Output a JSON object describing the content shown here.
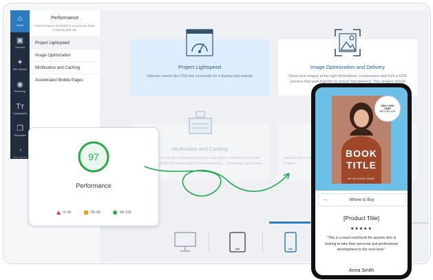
{
  "sidebar": {
    "items": [
      {
        "label": "Home",
        "icon": "home-icon",
        "glyph": "⌂"
      },
      {
        "label": "Themes",
        "icon": "themes-icon",
        "glyph": "▣"
      },
      {
        "label": "Site Wizard",
        "icon": "wand-icon",
        "glyph": "✦"
      },
      {
        "label": "Branding",
        "icon": "palette-icon",
        "glyph": "◉"
      },
      {
        "label": "Typography",
        "icon": "typography-icon",
        "glyph": "Tт"
      },
      {
        "label": "Templates",
        "icon": "templates-icon",
        "glyph": "❐"
      },
      {
        "label": "Site Speed",
        "icon": "gauge-icon",
        "glyph": "◔"
      }
    ]
  },
  "panel": {
    "title": "Performance",
    "subtitle": "A performance checklist to ensure you have a blazing fast site",
    "menu": [
      "Project Lightspeed",
      "Image Optimization",
      "Minification and Caching",
      "Accelerated Mobile Pages"
    ]
  },
  "cards": {
    "lightspeed": {
      "title": "Project Lightspeed",
      "desc": "Optimize assets like CSS and Javascript for a blazing fast website"
    },
    "image": {
      "title": "Image Optimization and Delivery",
      "desc": "Serve your images at the right dimensions, compression and from a CDN (servers that work together to ensure fast delivery). Your images should"
    },
    "minify": {
      "title": "Minification and Caching",
      "desc": "the size of your site by compressing scripts and styles. number of your site loading. WordPress for better perfor to faster loading ... Extremely fast speed"
    },
    "amp": {
      "title": "Activate Acce",
      "desc": "Activate Acce your images"
    }
  },
  "performance": {
    "score": "97",
    "label": "Performance",
    "legend": [
      {
        "range": "0–49",
        "color": "#e5393b"
      },
      {
        "range": "50–89",
        "color": "#f0a020"
      },
      {
        "range": "90–100",
        "color": "#2aa84a"
      }
    ]
  },
  "phone": {
    "badge": [
      "NEW YORK",
      "TIMES",
      "BESTSELLER"
    ],
    "book": {
      "line1": "BOOK",
      "line2": "TITLE",
      "author": "BY AUTHOR NAME"
    },
    "buy_label": "Where to Buy",
    "review": {
      "title": "[Product Title]",
      "stars": "★★★★★",
      "text": "\"This is a must-read book for anyone who is looking to take their personal and professional development to the next level.\"",
      "name": "Anna Smith"
    }
  },
  "colors": {
    "accent": "#2b7bbf",
    "score_green": "#2aa84a",
    "arrow": "#1ea94d",
    "rail_bg": "#1f2d3d"
  }
}
